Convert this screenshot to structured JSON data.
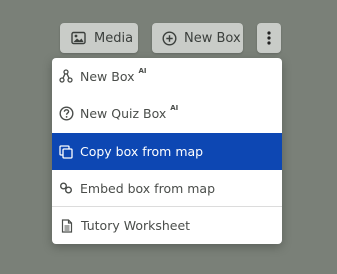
{
  "toolbar": {
    "media_label": "Media",
    "new_box_label": "New Box"
  },
  "menu": {
    "items": [
      {
        "label": "New Box",
        "badge": "AI",
        "icon": "hub-icon"
      },
      {
        "label": "New Quiz Box",
        "badge": "AI",
        "icon": "question-circle-icon"
      },
      {
        "label": "Copy box from map",
        "icon": "copy-icon",
        "highlighted": true
      },
      {
        "label": "Embed box from map",
        "icon": "link-icon"
      },
      {
        "label": "Tutory Worksheet",
        "icon": "document-icon"
      }
    ]
  },
  "colors": {
    "background": "#7a8078",
    "toolbar_button": "#c9ccc8",
    "highlight": "#0d47b3",
    "menu_text": "#4a4d4a"
  }
}
